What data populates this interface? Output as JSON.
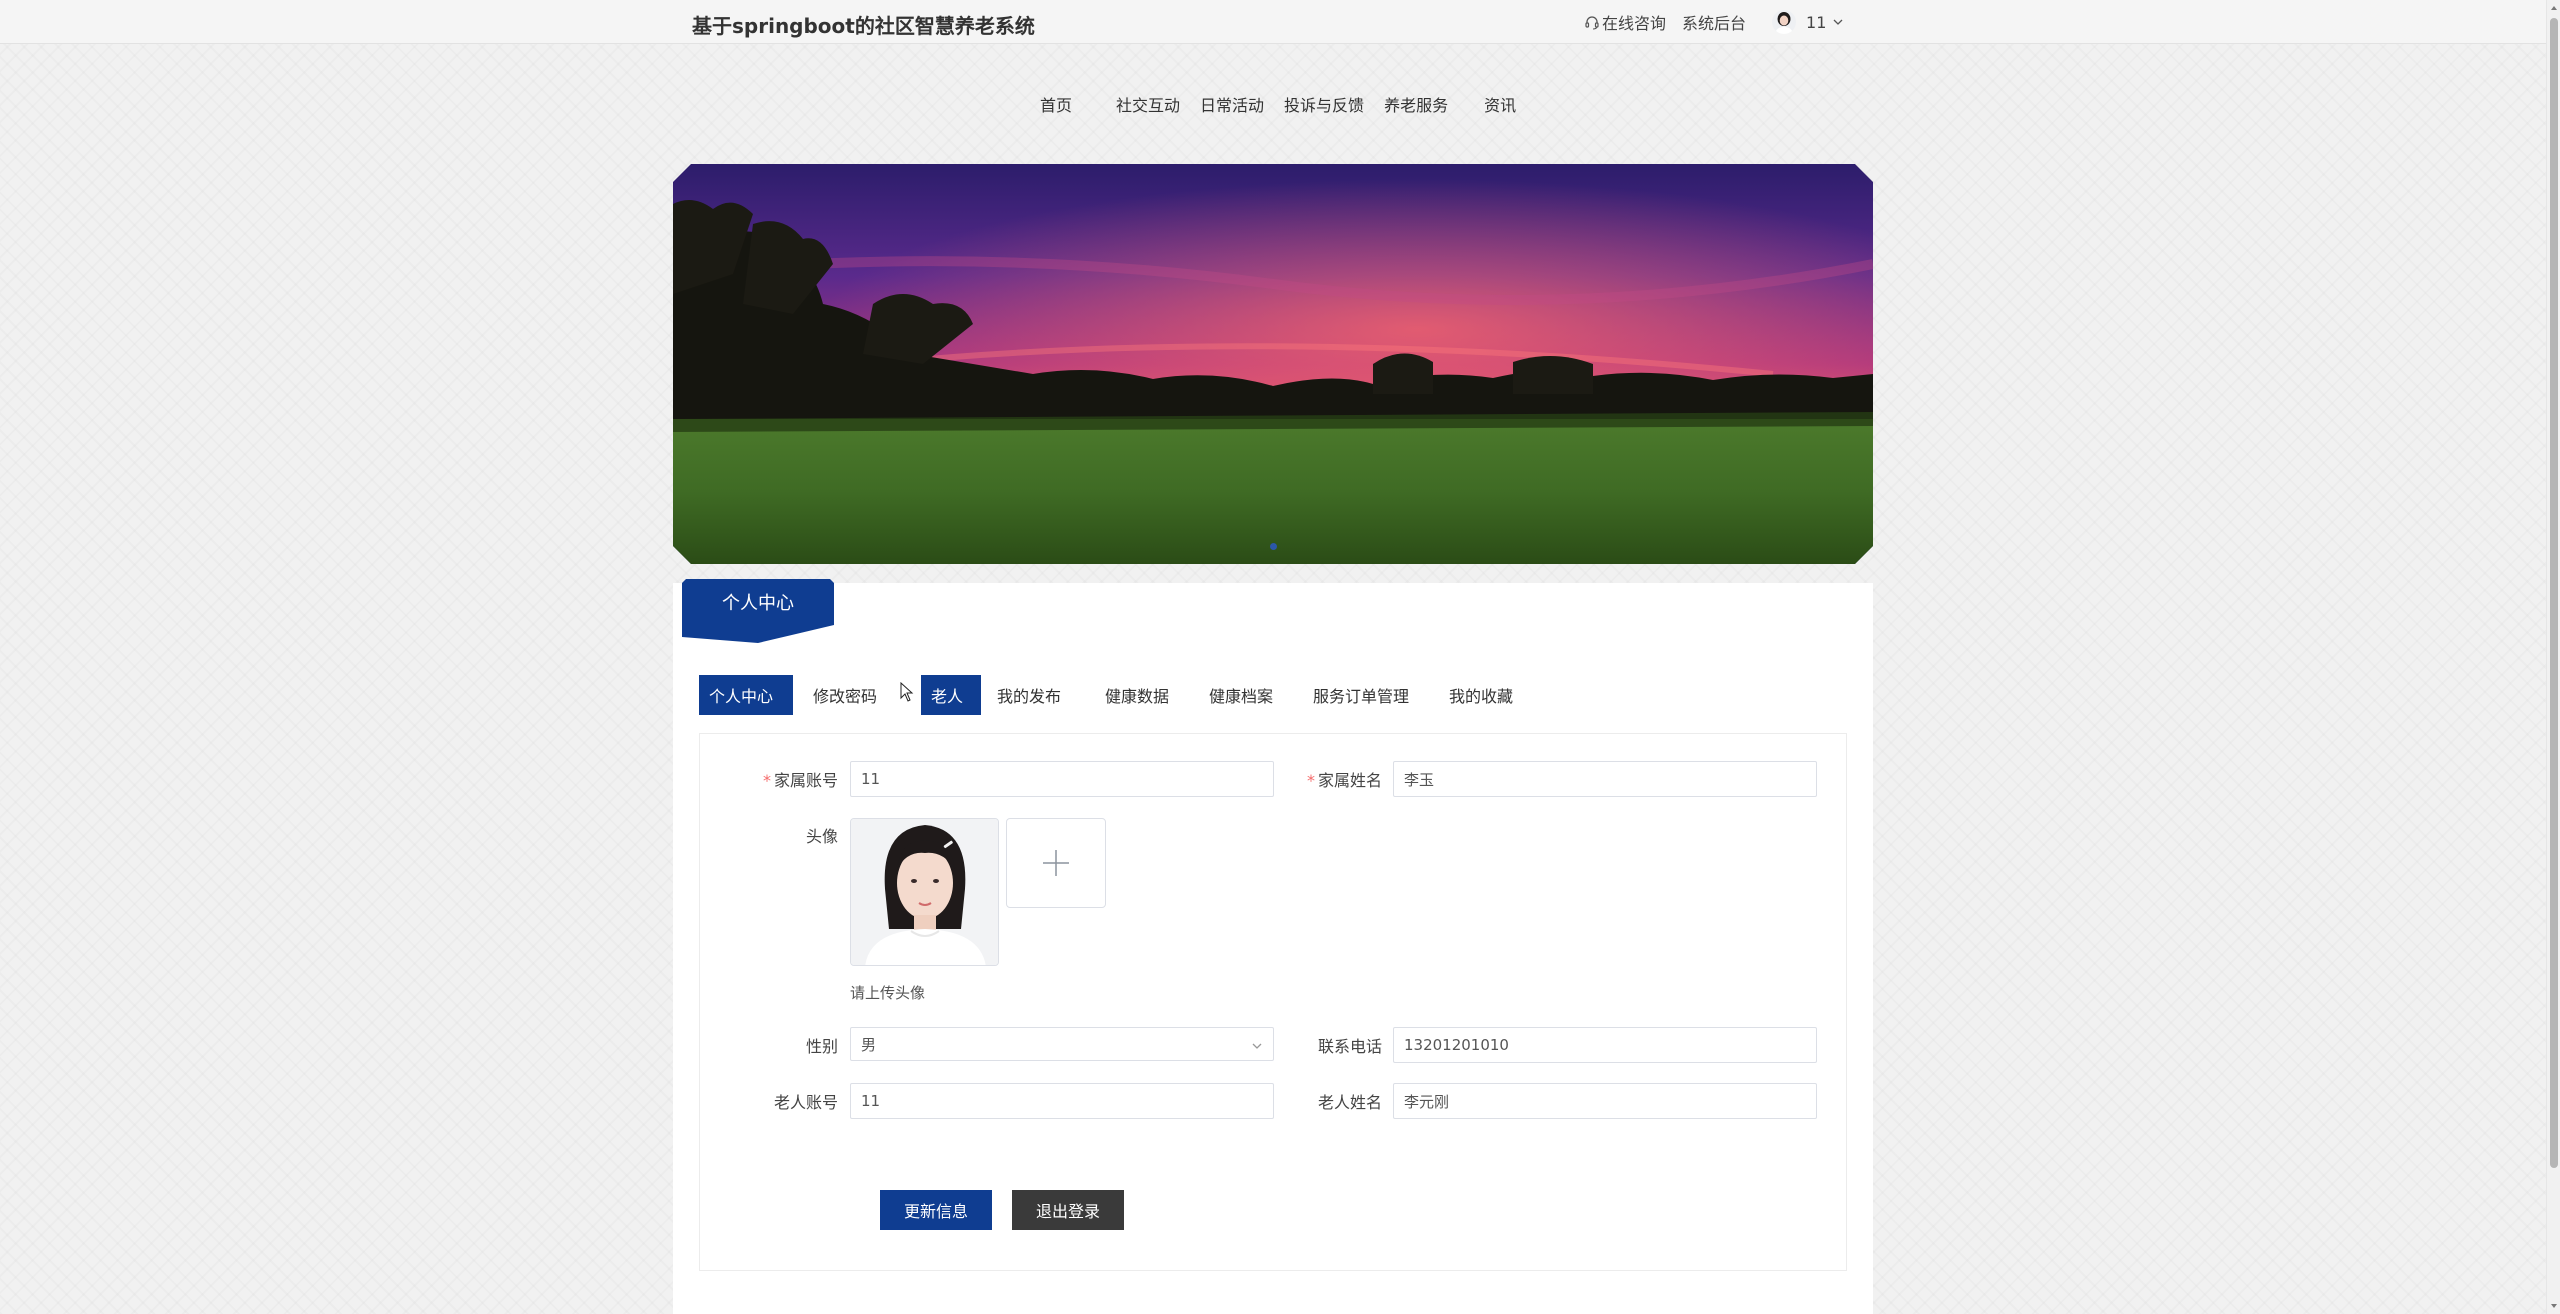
{
  "header": {
    "site_title": "基于springboot的社区智慧养老系统",
    "consult_label": "在线咨询",
    "admin_label": "系统后台",
    "username": "11"
  },
  "nav": {
    "items": [
      {
        "label": "首页"
      },
      {
        "label": "社交互动"
      },
      {
        "label": "日常活动"
      },
      {
        "label": "投诉与反馈"
      },
      {
        "label": "养老服务"
      },
      {
        "label": "资讯"
      }
    ]
  },
  "banner": {
    "slide_count": 1,
    "active_slide": 1
  },
  "panel": {
    "title": "个人中心"
  },
  "tabs": [
    {
      "label": "个人中心",
      "active": true
    },
    {
      "label": "修改密码",
      "active": false
    },
    {
      "label": "老人",
      "active": true
    },
    {
      "label": "我的发布",
      "active": false
    },
    {
      "label": "健康数据",
      "active": false
    },
    {
      "label": "健康档案",
      "active": false
    },
    {
      "label": "服务订单管理",
      "active": false
    },
    {
      "label": "我的收藏",
      "active": false
    }
  ],
  "form": {
    "family_account": {
      "label": "家属账号",
      "value": "11",
      "required": true
    },
    "family_name": {
      "label": "家属姓名",
      "value": "李玉",
      "required": true
    },
    "avatar": {
      "label": "头像",
      "hint": "请上传头像"
    },
    "gender": {
      "label": "性别",
      "value": "男"
    },
    "phone": {
      "label": "联系电话",
      "value": "13201201010"
    },
    "elder_account": {
      "label": "老人账号",
      "value": "11"
    },
    "elder_name": {
      "label": "老人姓名",
      "value": "李元刚"
    },
    "required_mark": "*"
  },
  "buttons": {
    "update": "更新信息",
    "logout": "退出登录"
  },
  "colors": {
    "primary": "#0f3d91",
    "dark_button": "#3a3a3a",
    "required": "#f56c6c"
  }
}
